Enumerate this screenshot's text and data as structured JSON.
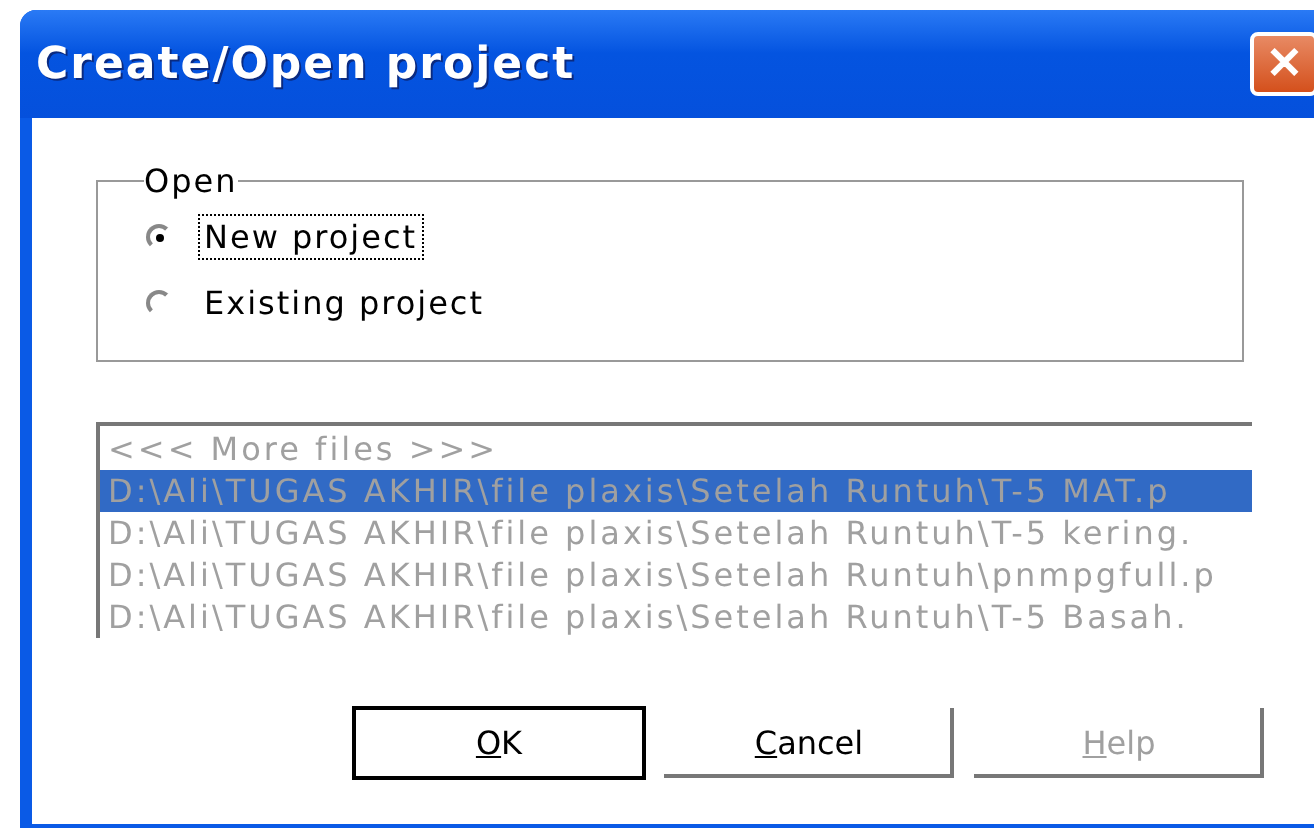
{
  "window": {
    "title": "Create/Open project",
    "close": "✕"
  },
  "open_group": {
    "label": "Open",
    "options": [
      {
        "label": "New project",
        "selected": true,
        "focused": true
      },
      {
        "label": "Existing project",
        "selected": false,
        "focused": false
      }
    ]
  },
  "file_list": {
    "items": [
      {
        "label": "<<< More files >>>",
        "selected": false
      },
      {
        "label": "D:\\Ali\\TUGAS AKHIR\\file plaxis\\Setelah Runtuh\\T-5 MAT.p",
        "selected": true
      },
      {
        "label": "D:\\Ali\\TUGAS AKHIR\\file plaxis\\Setelah Runtuh\\T-5 kering.",
        "selected": false
      },
      {
        "label": "D:\\Ali\\TUGAS AKHIR\\file plaxis\\Setelah Runtuh\\pnmpgfull.p",
        "selected": false
      },
      {
        "label": "D:\\Ali\\TUGAS AKHIR\\file plaxis\\Setelah Runtuh\\T-5 Basah.",
        "selected": false
      }
    ]
  },
  "buttons": [
    {
      "mnemonic": "O",
      "rest": "K",
      "default": true,
      "disabled": false
    },
    {
      "mnemonic": "C",
      "rest": "ancel",
      "default": false,
      "disabled": false
    },
    {
      "mnemonic": "H",
      "rest": "elp",
      "default": false,
      "disabled": true
    }
  ]
}
